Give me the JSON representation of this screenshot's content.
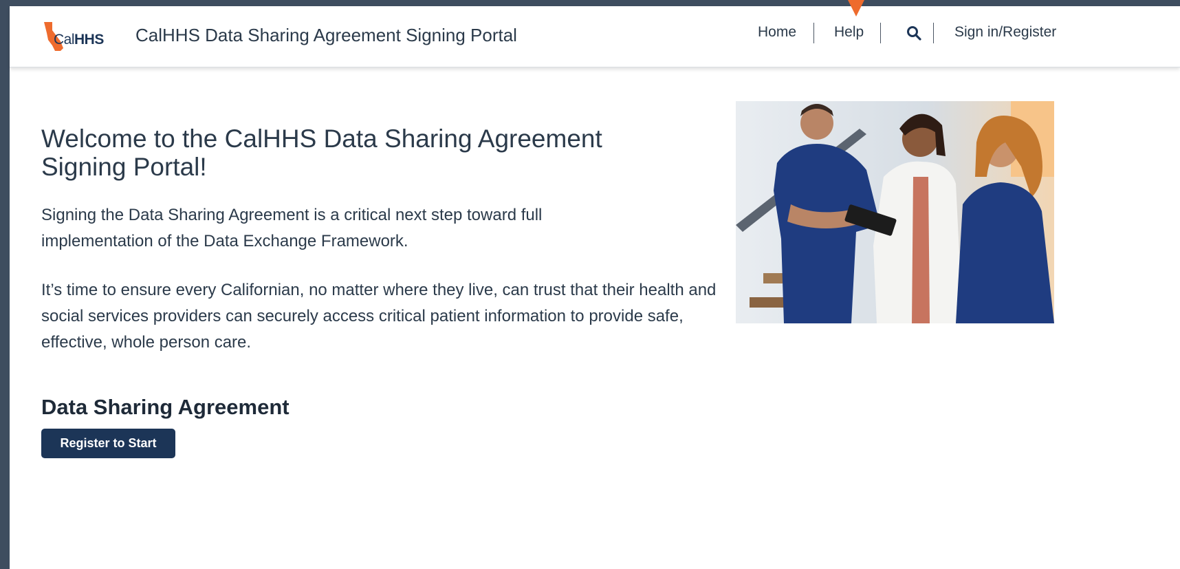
{
  "header": {
    "logo": {
      "text_cal": "Cal",
      "text_hhs": "HHS",
      "icon": "california-state-icon",
      "color": "#ee6b2d"
    },
    "site_title": "CalHHS Data Sharing Agreement Signing Portal",
    "nav": [
      {
        "label": "Home"
      },
      {
        "label": "Help"
      },
      {
        "label": "Sign in/Register"
      }
    ],
    "search_icon": "search-icon"
  },
  "annotation": {
    "icon": "pointer-arrow-icon",
    "color": "#ee6b2d"
  },
  "main": {
    "welcome_title": "Welcome to the CalHHS Data Sharing Agreement Signing Portal!",
    "paragraph_1": "Signing the Data Sharing Agreement is a critical next step toward full implementation of the Data Exchange Framework.",
    "paragraph_2": "It’s time to ensure every Californian, no matter where they live, can trust that their health and social services providers can securely access critical patient information to provide safe, effective, whole person care.",
    "section_heading": "Data Sharing Agreement",
    "register_button": "Register to Start"
  },
  "colors": {
    "brand_navy": "#1c3557",
    "brand_orange": "#ee6b2d",
    "outer_frame": "#3e4d5f",
    "text": "#2b3a4a"
  }
}
